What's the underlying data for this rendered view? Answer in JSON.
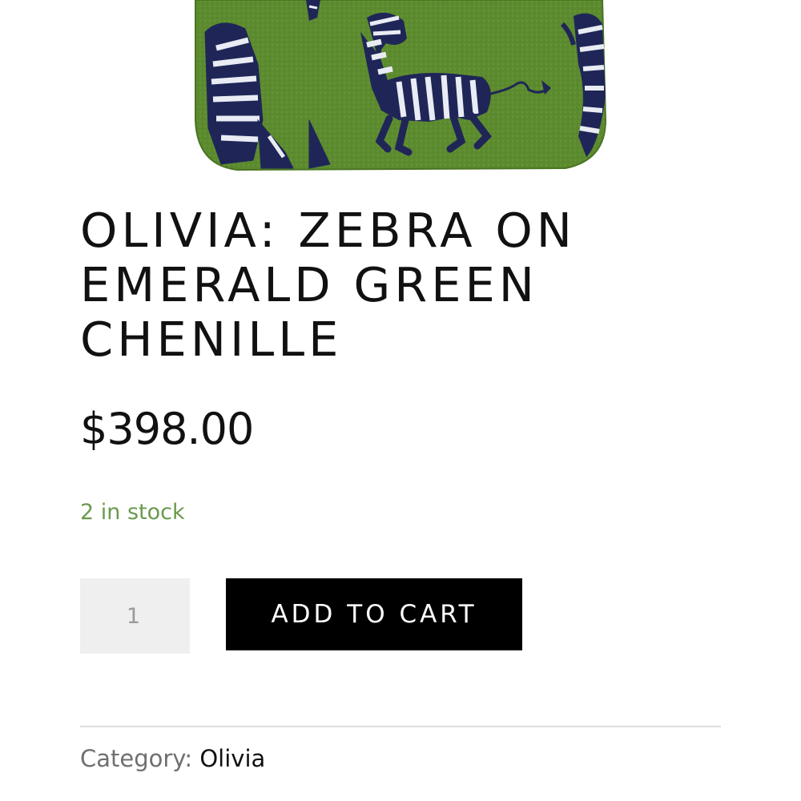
{
  "product": {
    "image_alt": "Zebra on emerald green chenille bag",
    "title": "OLIVIA: ZEBRA ON EMERALD GREEN CHENILLE",
    "price": "$398.00",
    "stock": "2 in stock",
    "quantity": "1",
    "add_to_cart_label": "ADD TO CART",
    "category_label": "Category:",
    "category_value": "Olivia"
  },
  "colors": {
    "stock_text": "#6a9a4e",
    "button_bg": "#000000",
    "button_text": "#ffffff",
    "image_green": "#5b8a2e",
    "zebra_navy": "#1f2657"
  }
}
